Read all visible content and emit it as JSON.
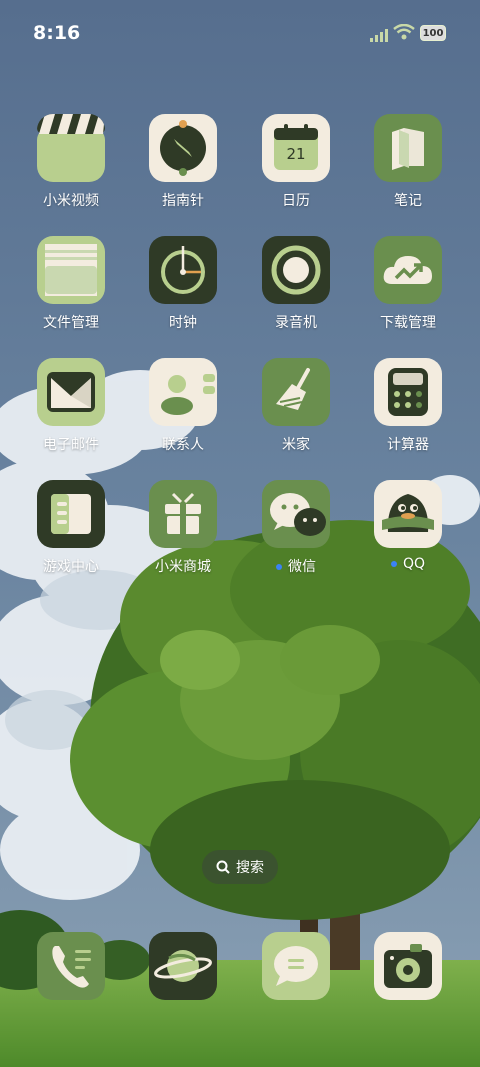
{
  "status_bar": {
    "time": "8:16",
    "battery": "100"
  },
  "apps": [
    {
      "label": "小米视频",
      "icon": "video-icon"
    },
    {
      "label": "指南针",
      "icon": "compass-icon"
    },
    {
      "label": "日历",
      "icon": "calendar-icon",
      "date": "21"
    },
    {
      "label": "笔记",
      "icon": "notes-icon"
    },
    {
      "label": "文件管理",
      "icon": "folder-icon"
    },
    {
      "label": "时钟",
      "icon": "clock-icon"
    },
    {
      "label": "录音机",
      "icon": "recorder-icon"
    },
    {
      "label": "下载管理",
      "icon": "download-cloud-icon"
    },
    {
      "label": "电子邮件",
      "icon": "mail-icon"
    },
    {
      "label": "联系人",
      "icon": "contacts-icon"
    },
    {
      "label": "米家",
      "icon": "broom-icon"
    },
    {
      "label": "计算器",
      "icon": "calculator-icon"
    },
    {
      "label": "游戏中心",
      "icon": "book-icon"
    },
    {
      "label": "小米商城",
      "icon": "gift-icon"
    },
    {
      "label": "微信",
      "icon": "wechat-icon",
      "new": true
    },
    {
      "label": "QQ",
      "icon": "qq-penguin-icon",
      "new": true
    }
  ],
  "search": {
    "label": "搜索"
  },
  "dock": [
    {
      "icon": "phone-icon"
    },
    {
      "icon": "browser-planet-icon"
    },
    {
      "icon": "messages-icon"
    },
    {
      "icon": "camera-icon"
    }
  ],
  "colors": {
    "icon_green": "#6a8f4e",
    "icon_light": "#b8cf8e",
    "icon_dark": "#2f3a26",
    "icon_cream": "#f3ecdf",
    "sky": "#5a7494"
  }
}
